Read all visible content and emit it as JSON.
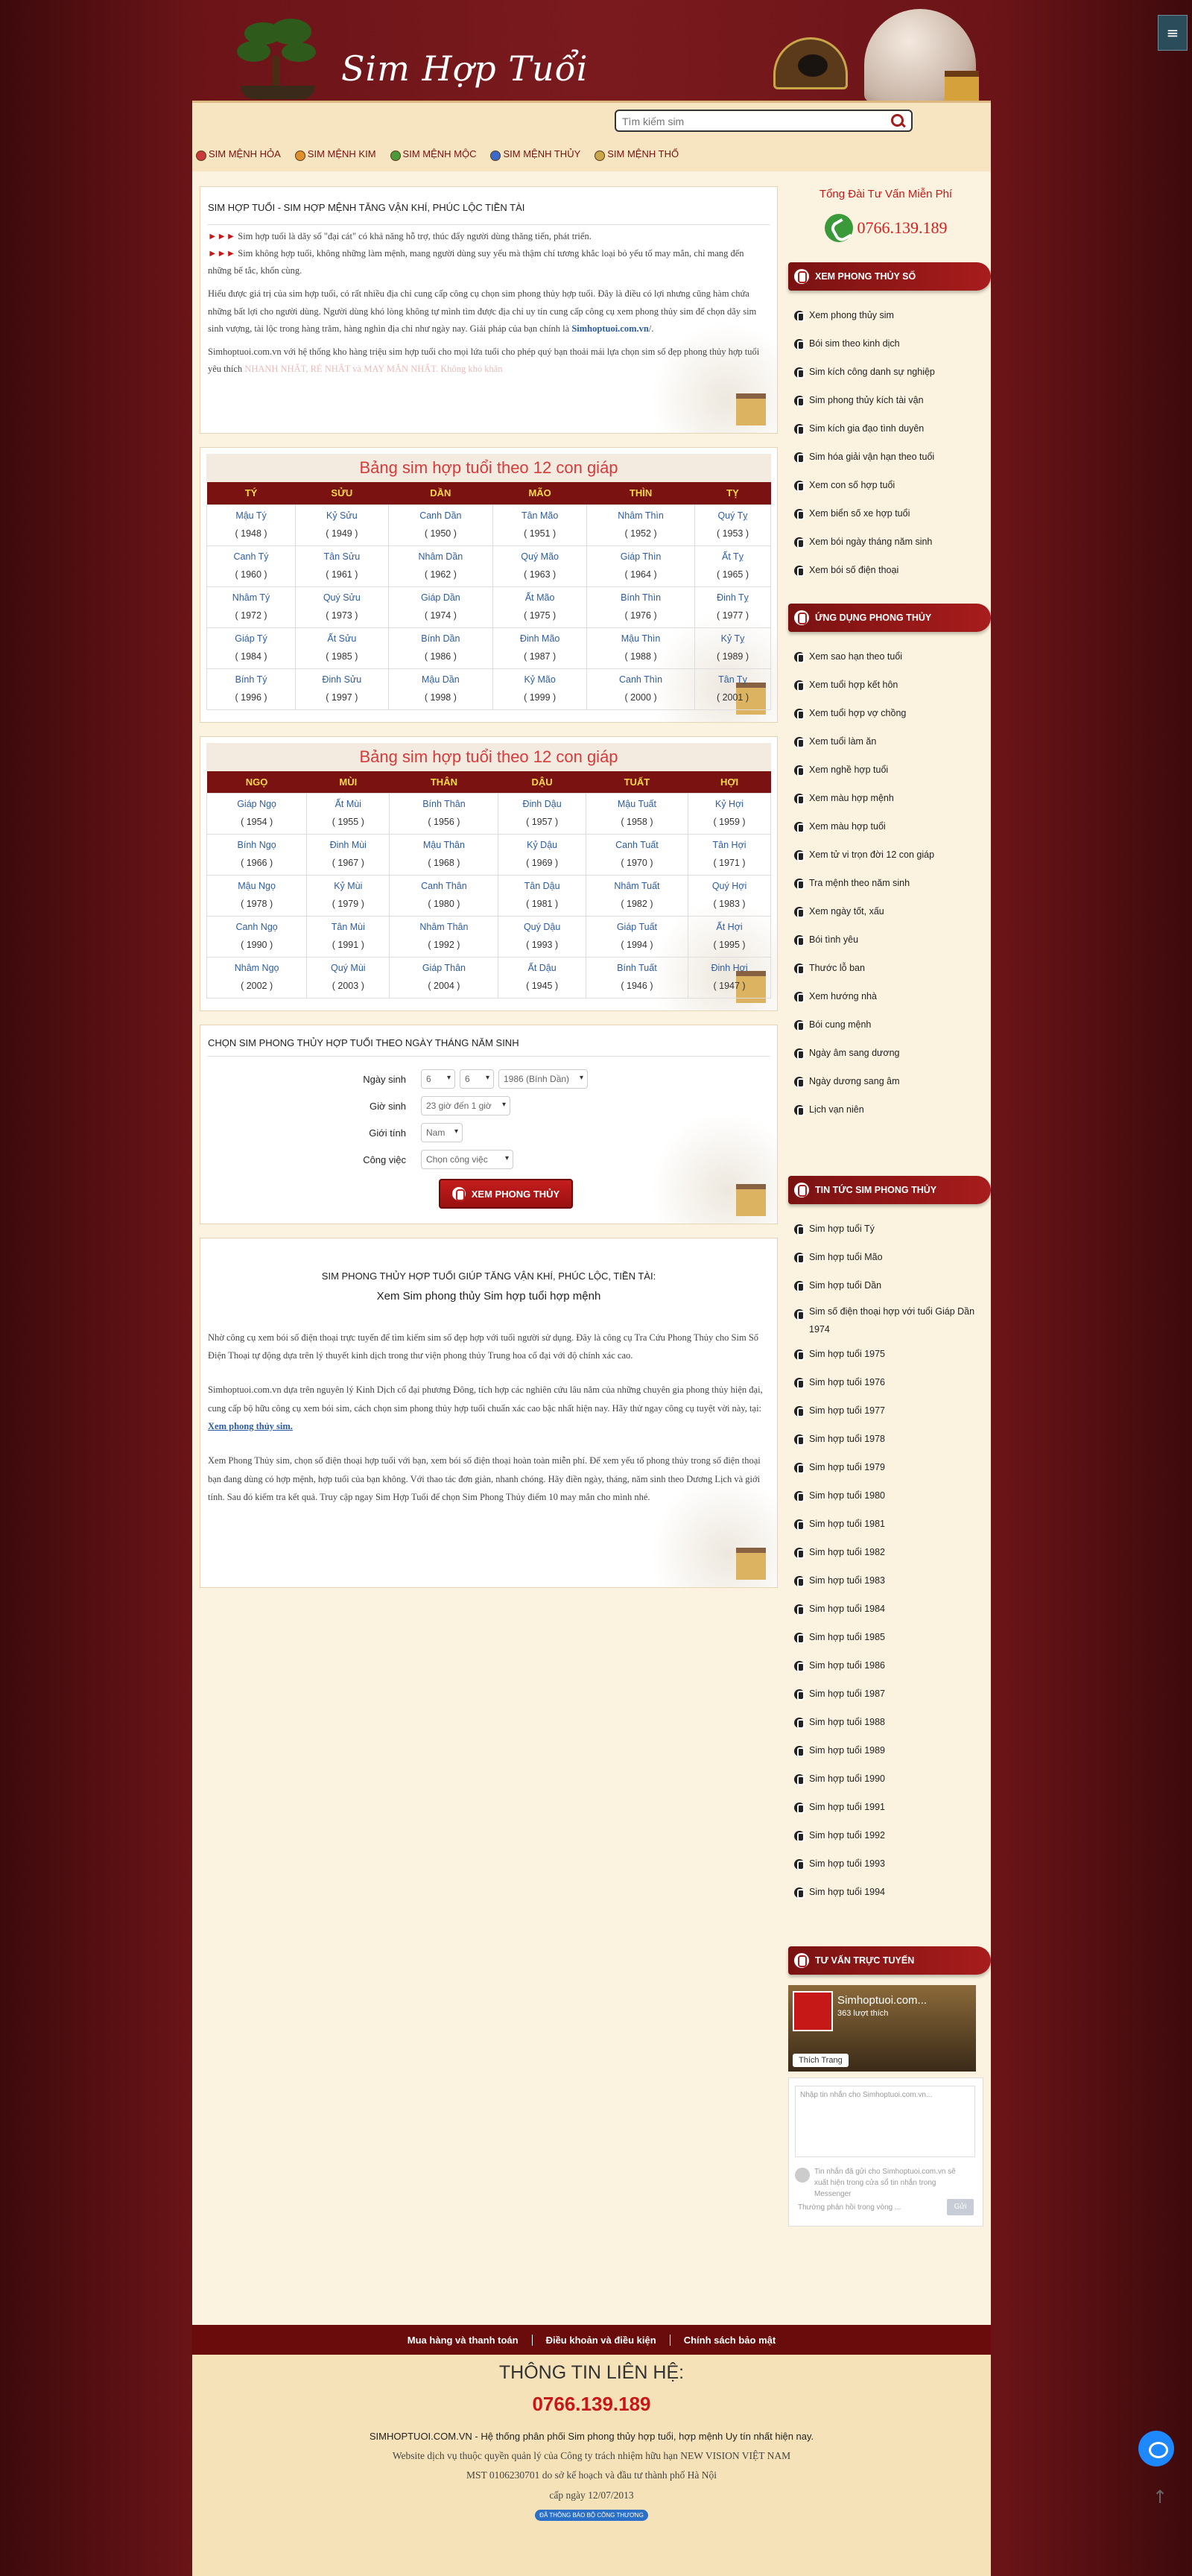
{
  "header": {
    "logo_text": "Sim Hợp Tuổi",
    "search_placeholder": "Tìm kiếm sim"
  },
  "menu": [
    "SIM MỆNH HỎA",
    "SIM MỆNH KIM",
    "SIM MỆNH MỘC",
    "SIM MỆNH THỦY",
    "SIM MỆNH THỔ"
  ],
  "intro": {
    "title": "SIM HỢP TUỔI - SIM HỢP MỆNH TĂNG VẬN KHÍ, PHÚC LỘC TIỀN TÀI",
    "arrows": "►►►",
    "p1": "Sim hợp tuổi là dãy số \"đại cát\" có khả năng hỗ trợ, thúc đẩy người dùng thăng tiến, phát triển.",
    "p2": "Sim không hợp tuổi, không những làm mệnh, mang người dùng suy yếu mà thậm chí tương khắc loại bỏ yếu tố may mắn, chỉ mang đến những bế tắc, khốn cùng.",
    "p3": "Hiểu được giá trị của sim hợp tuổi, có rất nhiều địa chỉ cung cấp công cụ chọn sim phong thủy hợp tuổi. Đây là điều có lợi nhưng cũng hàm chứa những bất lợi cho người dùng. Người dùng khó lòng không tự mình tìm được địa chỉ uy tín cung cấp công cụ xem phong thủy sim để chọn dãy sim sinh vượng, tài lộc trong hàng trăm, hàng nghìn địa chỉ như ngày nay. Giải pháp của bạn chính là",
    "p3_link": "Simhoptuoi.com.vn",
    "p4": "Simhoptuoi.com.vn với hệ thống kho hàng triệu sim hợp tuổi cho mọi lứa tuổi cho phép quý bạn thoải mái lựa chọn sim số đẹp phong thủy hợp tuổi yêu thích",
    "p4_faded": "NHANH NHẤT, RẺ NHẤT và MAY MẮN NHẤT. Không khó khăn"
  },
  "table1": {
    "title": "Bảng sim hợp tuổi theo 12 con giáp",
    "headers": [
      "TÝ",
      "SỬU",
      "DẦN",
      "MÃO",
      "THÌN",
      "TỴ"
    ],
    "rows": [
      [
        [
          "Mậu Tý",
          "1948"
        ],
        [
          "Kỷ Sửu",
          "1949"
        ],
        [
          "Canh Dần",
          "1950"
        ],
        [
          "Tân Mão",
          "1951"
        ],
        [
          "Nhâm Thìn",
          "1952"
        ],
        [
          "Quý Tỵ",
          "1953"
        ]
      ],
      [
        [
          "Canh Tý",
          "1960"
        ],
        [
          "Tân Sửu",
          "1961"
        ],
        [
          "Nhâm Dần",
          "1962"
        ],
        [
          "Quý Mão",
          "1963"
        ],
        [
          "Giáp Thìn",
          "1964"
        ],
        [
          "Ất Tỵ",
          "1965"
        ]
      ],
      [
        [
          "Nhâm Tý",
          "1972"
        ],
        [
          "Quý Sửu",
          "1973"
        ],
        [
          "Giáp Dần",
          "1974"
        ],
        [
          "Ất Mão",
          "1975"
        ],
        [
          "Bính Thìn",
          "1976"
        ],
        [
          "Đinh Tỵ",
          "1977"
        ]
      ],
      [
        [
          "Giáp Tý",
          "1984"
        ],
        [
          "Ất Sửu",
          "1985"
        ],
        [
          "Bính Dần",
          "1986"
        ],
        [
          "Đinh Mão",
          "1987"
        ],
        [
          "Mậu Thìn",
          "1988"
        ],
        [
          "Kỷ Tỵ",
          "1989"
        ]
      ],
      [
        [
          "Bính Tý",
          "1996"
        ],
        [
          "Đinh Sửu",
          "1997"
        ],
        [
          "Mậu Dần",
          "1998"
        ],
        [
          "Kỷ Mão",
          "1999"
        ],
        [
          "Canh Thìn",
          "2000"
        ],
        [
          "Tân Tỵ",
          "2001"
        ]
      ]
    ]
  },
  "table2": {
    "title": "Bảng sim hợp tuổi theo 12 con giáp",
    "headers": [
      "NGỌ",
      "MÙI",
      "THÂN",
      "DẬU",
      "TUẤT",
      "HỢI"
    ],
    "rows": [
      [
        [
          "Giáp Ngọ",
          "1954"
        ],
        [
          "Ất Mùi",
          "1955"
        ],
        [
          "Bính Thân",
          "1956"
        ],
        [
          "Đinh Dậu",
          "1957"
        ],
        [
          "Mậu Tuất",
          "1958"
        ],
        [
          "Kỷ Hợi",
          "1959"
        ]
      ],
      [
        [
          "Bính Ngọ",
          "1966"
        ],
        [
          "Đinh Mùi",
          "1967"
        ],
        [
          "Mậu Thân",
          "1968"
        ],
        [
          "Kỷ Dậu",
          "1969"
        ],
        [
          "Canh Tuất",
          "1970"
        ],
        [
          "Tân Hợi",
          "1971"
        ]
      ],
      [
        [
          "Mậu Ngọ",
          "1978"
        ],
        [
          "Kỷ Mùi",
          "1979"
        ],
        [
          "Canh Thân",
          "1980"
        ],
        [
          "Tân Dậu",
          "1981"
        ],
        [
          "Nhâm Tuất",
          "1982"
        ],
        [
          "Quý Hợi",
          "1983"
        ]
      ],
      [
        [
          "Canh Ngọ",
          "1990"
        ],
        [
          "Tân Mùi",
          "1991"
        ],
        [
          "Nhâm Thân",
          "1992"
        ],
        [
          "Quý Dậu",
          "1993"
        ],
        [
          "Giáp Tuất",
          "1994"
        ],
        [
          "Ất Hợi",
          "1995"
        ]
      ],
      [
        [
          "Nhâm Ngọ",
          "2002"
        ],
        [
          "Quý Mùi",
          "2003"
        ],
        [
          "Giáp Thân",
          "2004"
        ],
        [
          "Ất Dậu",
          "1945"
        ],
        [
          "Bính Tuất",
          "1946"
        ],
        [
          "Đinh Hợi",
          "1947"
        ]
      ]
    ]
  },
  "form": {
    "title": "CHỌN SIM PHONG THỦY HỢP TUỔI THEO NGÀY THÁNG NĂM SINH",
    "label_dob": "Ngày sinh",
    "day": "6",
    "month": "6",
    "year": "1986 (Bính Dần)",
    "label_hour": "Giờ sinh",
    "hour": "23 giờ đến 1 giờ",
    "label_gender": "Giới tính",
    "gender": "Nam",
    "label_job": "Công việc",
    "job": "Chọn công việc",
    "button": "XEM PHONG THỦY"
  },
  "about": {
    "title": "SIM PHONG THỦY HỢP TUỔI GIÚP TĂNG VẬN KHÍ, PHÚC LỘC, TIỀN TÀI:",
    "subtitle": "Xem Sim phong thủy Sim hợp tuổi hợp mệnh",
    "p1": "Nhờ công cụ xem bói số điện thoại trực tuyến để tìm kiếm sim số đẹp hợp với tuổi người sử dụng. Đây là công cụ Tra Cứu Phong Thủy cho Sim Số Điện Thoại tự động dựa trên lý thuyết kinh dịch trong thư viện phong thủy Trung hoa cổ đại với độ chính xác cao.",
    "p2": "Simhoptuoi.com.vn dựa trên nguyên lý Kinh Dịch cổ đại phương Đông, tích hợp các nghiên cứu lâu năm của những chuyên gia phong thủy hiện đại, cung cấp bộ hữu công cụ xem bói sim, cách chọn sim phong thủy hợp tuổi chuẩn xác cao bậc nhất hiện nay. Hãy thử ngay công cụ tuyệt vời này, tại:",
    "p2_link": "Xem phong thủy sim.",
    "p3": "Xem Phong Thủy sim, chọn số điện thoại hợp tuổi với bạn, xem bói số điện thoại hoàn toàn miễn phí. Để xem yếu tố phong thủy trong số điện thoại bạn đang dùng có hợp mệnh, hợp tuổi của bạn không. Với thao tác đơn giản, nhanh chóng. Hãy điền ngày, tháng, năm sinh theo Dương Lịch và giới tính. Sau đó kiểm tra kết quả. Truy cập ngay Sim Hợp Tuổi để chọn Sim Phong Thủy điểm 10 may mắn cho mình nhé."
  },
  "sidebar": {
    "hotline_title": "Tổng Đài Tư Vấn Miễn Phí",
    "hotline": "0766.139.189",
    "sec1_title": "XEM PHONG THỦY SỐ",
    "sec1": [
      "Xem phong thủy sim",
      "Bói sim theo kinh dịch",
      "Sim kích công danh sự nghiệp",
      "Sim phong thủy kích tài vận",
      "Sim kích gia đạo tình duyên",
      "Sim hóa giải vận hạn theo tuổi",
      "Xem con số hợp tuổi",
      "Xem biển số xe hợp tuổi",
      "Xem bói ngày tháng năm sinh",
      "Xem bói số điện thoại"
    ],
    "sec2_title": "ỨNG DỤNG PHONG THỦY",
    "sec2": [
      "Xem sao hạn theo tuổi",
      "Xem tuổi hợp kết hôn",
      "Xem tuổi hợp vợ chồng",
      "Xem tuổi làm ăn",
      "Xem nghề hợp tuổi",
      "Xem màu hợp mệnh",
      "Xem màu hợp tuổi",
      "Xem tử vi trọn đời 12 con giáp",
      "Tra mệnh theo năm sinh",
      "Xem ngày tốt, xấu",
      "Bói tình yêu",
      "Thước lỗ ban",
      "Xem hướng nhà",
      "Bói cung mệnh",
      "Ngày âm sang dương",
      "Ngày dương sang âm",
      "Lịch vạn niên"
    ],
    "sec3_title": "TIN TỨC SIM PHONG THỦY",
    "sec3": [
      "Sim hợp tuổi Tý",
      "Sim hợp tuổi Mão",
      "Sim hợp tuổi Dần",
      "Sim số điện thoại hợp với tuổi Giáp Dần 1974",
      "Sim hợp tuổi 1975",
      "Sim hợp tuổi 1976",
      "Sim hợp tuổi 1977",
      "Sim hợp tuổi 1978",
      "Sim hợp tuổi 1979",
      "Sim hợp tuổi 1980",
      "Sim hợp tuổi 1981",
      "Sim hợp tuổi 1982",
      "Sim hợp tuổi 1983",
      "Sim hợp tuổi 1984",
      "Sim hợp tuổi 1985",
      "Sim hợp tuổi 1986",
      "Sim hợp tuổi 1987",
      "Sim hợp tuổi 1988",
      "Sim hợp tuổi 1989",
      "Sim hợp tuổi 1990",
      "Sim hợp tuổi 1991",
      "Sim hợp tuổi 1992",
      "Sim hợp tuổi 1993",
      "Sim hợp tuổi 1994"
    ],
    "sec4_title": "TƯ VẤN TRỰC TUYẾN",
    "fb_name": "Simhoptuoi.com...",
    "fb_count": "363 lượt thích",
    "fb_like": "Thích Trang",
    "chat_placeholder": "Nhập tin nhắn cho Simhoptuoi.com.vn...",
    "chat_note": "Tin nhắn đã gửi cho Simhoptuoi.com.vn sẽ xuất hiện trong cửa sổ tin nhắn trong Messenger",
    "chat_reply": "Thường phản hồi trong vòng ...",
    "chat_send": "Gửi"
  },
  "footer": {
    "links": [
      "Mua hàng và thanh toán",
      "Điều khoản và điều kiện",
      "Chính sách bảo mật"
    ],
    "contact_title": "THÔNG TIN LIÊN HỆ:",
    "phone": "0766.139.189",
    "line1": "SIMHOPTUOI.COM.VN - Hệ thống phân phối Sim phong thủy hợp tuổi, hợp mệnh Uy tín nhất hiện nay.",
    "line2": "Website dịch vụ thuộc quyền quản lý của Công ty trách nhiệm hữu hạn NEW VISION VIỆT NAM",
    "line3": "MST 0106230701 do sở kế hoạch và đầu tư thành phố Hà Nội",
    "line4": "cấp ngày 12/07/2013",
    "badge": "ĐÃ THÔNG BÁO BỘ CÔNG THƯƠNG"
  }
}
